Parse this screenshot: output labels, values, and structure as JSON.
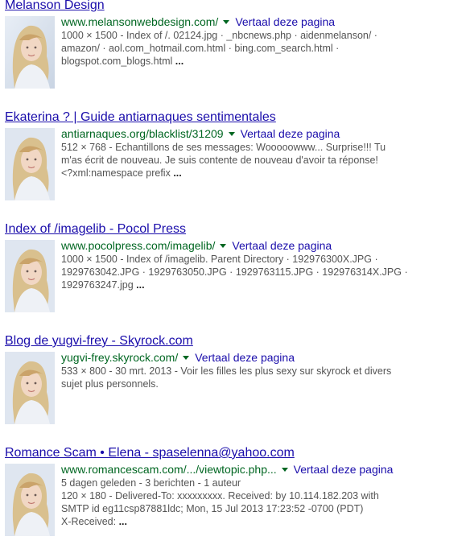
{
  "results": [
    {
      "title": "Melanson Design",
      "url": "www.melansonwebdesign.com/",
      "translate": "Vertaal deze pagina",
      "lines": [
        "1000 × 1500 - Index of /. 02124.jpg · _nbcnews.php · aidenmelanson/ ·",
        "amazon/ · aol.com_hotmail.com.html · bing.com_search.html ·",
        "blogspot.com_blogs.html"
      ],
      "ellipsis": "..."
    },
    {
      "title": "Ekaterina ? | Guide antiarnaques sentimentales",
      "url": "antiarnaques.org/blacklist/31209",
      "translate": "Vertaal deze pagina",
      "lines": [
        "512 × 768 - Echantillons de ses messages: Wooooowww... Surprise!!! Tu",
        "m'as écrit de nouveau. Je suis contente de nouveau d'avoir ta réponse!",
        "<?xml:namespace prefix"
      ],
      "ellipsis": "..."
    },
    {
      "title": "Index of /imagelib - Pocol Press",
      "url": "www.pocolpress.com/imagelib/",
      "translate": "Vertaal deze pagina",
      "lines": [
        "1000 × 1500 - Index of /imagelib. Parent Directory · 192976300X.JPG ·",
        "1929763042.JPG · 1929763050.JPG · 1929763115.JPG · 192976314X.JPG ·",
        "1929763247.jpg"
      ],
      "ellipsis": "..."
    },
    {
      "title": "Blog de yugvi-frey - Skyrock.com",
      "url": "yugvi-frey.skyrock.com/",
      "translate": "Vertaal deze pagina",
      "lines": [
        "533 × 800 - 30 mrt. 2013 - Voir les filles les plus sexy sur skyrock et divers",
        "sujet plus personnels."
      ],
      "ellipsis": ""
    },
    {
      "title": "Romance Scam • Elena - spaselenna@yahoo.com",
      "url": "www.romancescam.com/.../viewtopic.php...",
      "translate": "Vertaal deze pagina",
      "lines": [
        "5 dagen geleden - 3 berichten - 1 auteur",
        "120 × 180 - Delivered-To: xxxxxxxxx. Received: by 10.114.182.203 with",
        "SMTP id eg11csp87881ldc; Mon, 15 Jul 2013 17:23:52 -0700 (PDT)",
        "X-Received:"
      ],
      "ellipsis": "..."
    }
  ]
}
